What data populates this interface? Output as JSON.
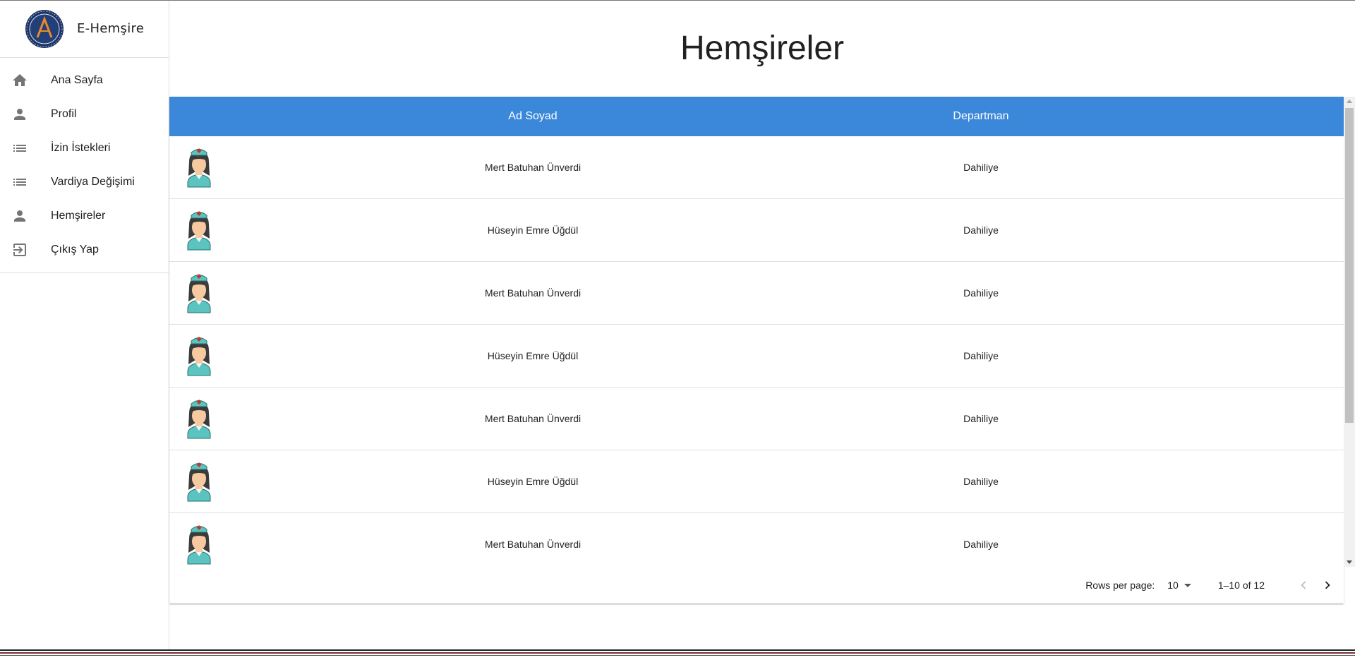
{
  "app": {
    "title": "E-Hemşire"
  },
  "sidebar": {
    "items": [
      {
        "label": "Ana Sayfa",
        "icon": "home-icon"
      },
      {
        "label": "Profil",
        "icon": "person-icon"
      },
      {
        "label": "İzin İstekleri",
        "icon": "list-icon"
      },
      {
        "label": "Vardiya Değişimi",
        "icon": "list-icon"
      },
      {
        "label": "Hemşireler",
        "icon": "person-icon"
      },
      {
        "label": "Çıkış Yap",
        "icon": "exit-icon"
      }
    ]
  },
  "main": {
    "title": "Hemşireler",
    "table": {
      "headers": {
        "avatar": "",
        "name": "Ad Soyad",
        "department": "Departman"
      },
      "header_color": "#3b87d9",
      "rows": [
        {
          "name": "Mert Batuhan Ünverdi",
          "department": "Dahiliye"
        },
        {
          "name": "Hüseyin Emre Üğdül",
          "department": "Dahiliye"
        },
        {
          "name": "Mert Batuhan Ünverdi",
          "department": "Dahiliye"
        },
        {
          "name": "Hüseyin Emre Üğdül",
          "department": "Dahiliye"
        },
        {
          "name": "Mert Batuhan Ünverdi",
          "department": "Dahiliye"
        },
        {
          "name": "Hüseyin Emre Üğdül",
          "department": "Dahiliye"
        },
        {
          "name": "Mert Batuhan Ünverdi",
          "department": "Dahiliye"
        }
      ]
    },
    "pagination": {
      "rows_per_page_label": "Rows per page:",
      "rows_per_page_value": "10",
      "range": "1–10 of 12"
    }
  }
}
